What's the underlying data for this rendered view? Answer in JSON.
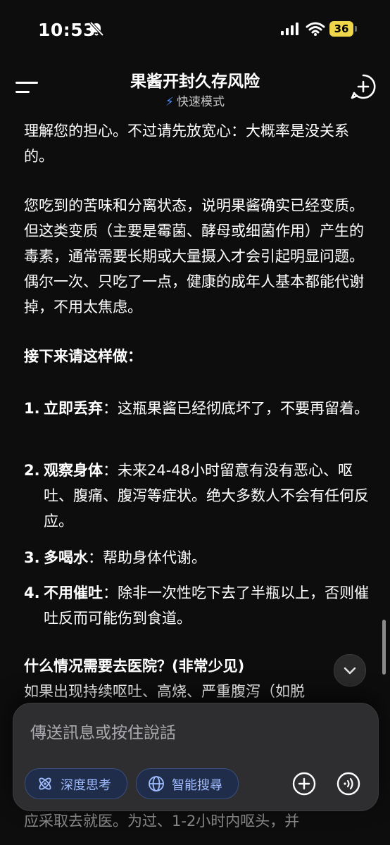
{
  "status_bar": {
    "time": "10:53",
    "battery": "36"
  },
  "header": {
    "title": "果酱开封久存风险",
    "mode": "快速模式"
  },
  "message": {
    "p1": "理解您的担心。不过请先放宽心：大概率是没关系的。",
    "p2": "您吃到的苦味和分离状态，说明果酱确实已经变质。但这类变质（主要是霉菌、酵母或细菌作用）产生的毒素，通常需要长期或大量摄入才会引起明显问题。偶尔一次、只吃了一点，健康的成年人基本都能代谢掉，不用太焦虑。",
    "steps_heading": "接下来请这样做：",
    "steps": [
      {
        "num": "1.",
        "bold": "立即丢弃",
        "text": "：这瓶果酱已经彻底坏了，不要再留着。"
      },
      {
        "num": "2.",
        "bold": "观察身体",
        "text": "：未来24-48小时留意有没有恶心、呕吐、腹痛、腹泻等症状。绝大多数人不会有任何反应。"
      },
      {
        "num": "3.",
        "bold": "多喝水",
        "text": "：帮助身体代谢。"
      },
      {
        "num": "4.",
        "bold": "不用催吐",
        "text": "：除非一次性吃下去了半瓶以上，否则催吐反而可能伤到食道。"
      }
    ],
    "hospital_heading": "什么情况需要去医院？(非常少见)",
    "hospital_text": "如果出现持续呕吐、高烧、严重腹泻（如脱",
    "hidden_line": "应采取去就医。为过、1-2小时内呕头，并"
  },
  "composer": {
    "placeholder": "傳送訊息或按住說話",
    "deep_think": "深度思考",
    "smart_search": "智能搜尋"
  },
  "colors": {
    "background": "#0d0d0d",
    "accent": "#4a8cff",
    "chip_bg": "#1f2c4a",
    "battery": "#f0d64a"
  }
}
